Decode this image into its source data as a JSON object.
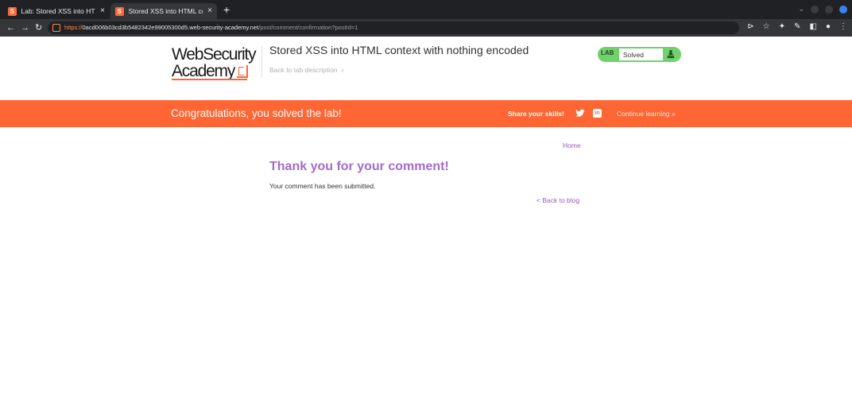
{
  "browser": {
    "tabs": [
      {
        "title": "Lab: Stored XSS into HTM",
        "active": false
      },
      {
        "title": "Stored XSS into HTML co",
        "active": true
      }
    ],
    "url": {
      "scheme": "https://",
      "host": "0acd006b03cd3b5482342e99005300d5.web-security-academy.net",
      "path": "/post/comment/confirmation?postId=1"
    }
  },
  "header": {
    "logo_line1": "WebSecurity",
    "logo_line2": "Academy",
    "lab_title": "Stored XSS into HTML context with nothing encoded",
    "back_to_lab": "Back to lab description",
    "status_lab": "LAB",
    "status_text": "Solved"
  },
  "banner": {
    "message": "Congratulations, you solved the lab!",
    "share_label": "Share your skills!",
    "continue_label": "Continue learning",
    "linkedin_text": "in"
  },
  "main": {
    "home_link": "Home",
    "heading": "Thank you for your comment!",
    "submitted": "Your comment has been submitted.",
    "back_to_blog": "< Back to blog"
  },
  "colors": {
    "brand_orange": "#ff6633",
    "solved_green": "#70d16d",
    "link_purple": "#9b59b6"
  }
}
